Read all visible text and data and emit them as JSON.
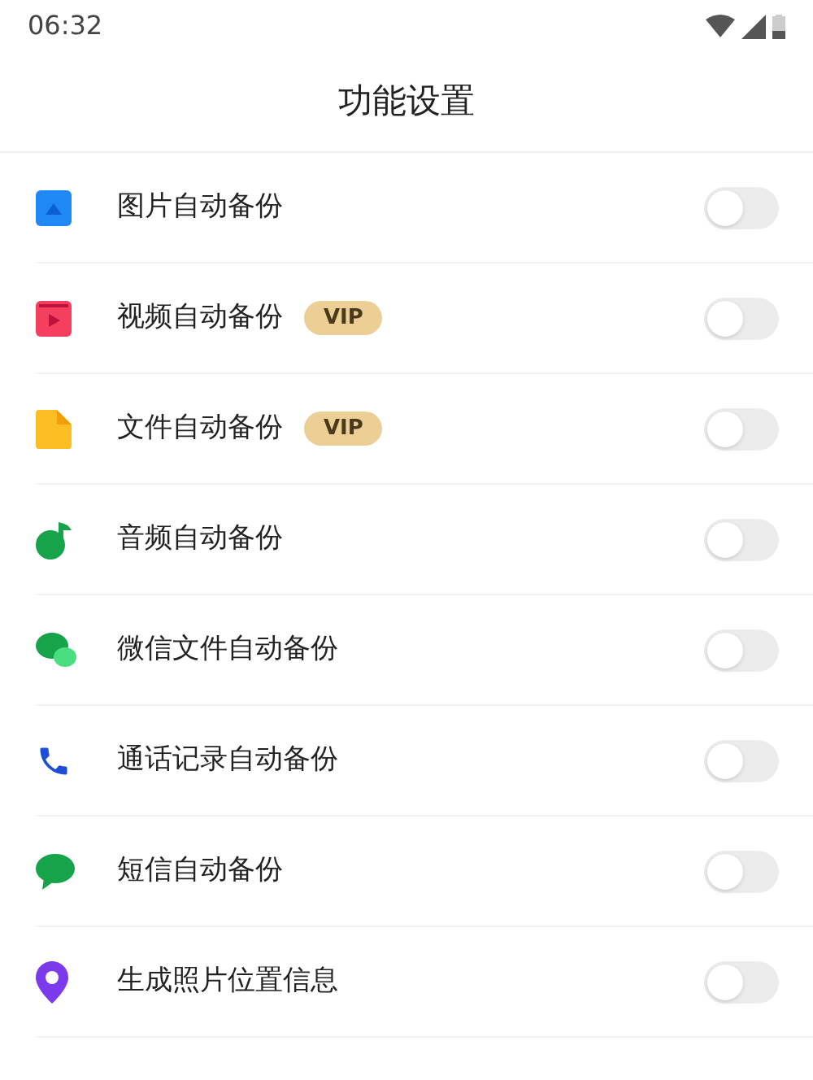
{
  "status_bar": {
    "time": "06:32"
  },
  "title": "功能设置",
  "items": [
    {
      "label": "图片自动备份",
      "on": false
    },
    {
      "label": "视频自动备份",
      "badge": "VIP",
      "on": false
    },
    {
      "label": "文件自动备份",
      "badge": "VIP",
      "on": false
    },
    {
      "label": "音频自动备份",
      "on": false
    },
    {
      "label": "微信文件自动备份",
      "on": false
    },
    {
      "label": "通话记录自动备份",
      "on": false
    },
    {
      "label": "短信自动备份",
      "on": false
    },
    {
      "label": "生成照片位置信息",
      "on": false
    }
  ]
}
